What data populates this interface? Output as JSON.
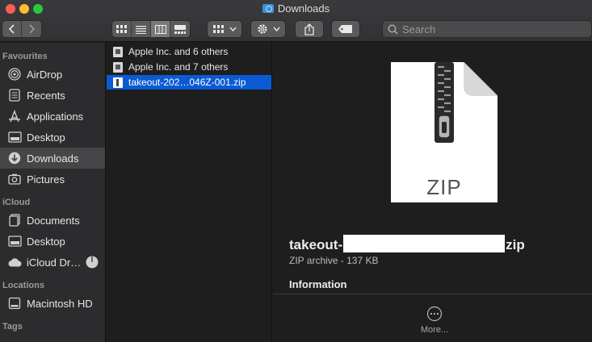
{
  "window": {
    "title": "Downloads"
  },
  "toolbar": {
    "view_modes": [
      "icon-view",
      "list-view",
      "column-view",
      "gallery-view"
    ],
    "active_view": "column-view"
  },
  "search": {
    "placeholder": "Search"
  },
  "sidebar": {
    "sections": [
      {
        "header": "Favourites",
        "items": [
          {
            "label": "AirDrop",
            "icon": "airdrop-icon"
          },
          {
            "label": "Recents",
            "icon": "recents-icon"
          },
          {
            "label": "Applications",
            "icon": "applications-icon"
          },
          {
            "label": "Desktop",
            "icon": "desktop-icon"
          },
          {
            "label": "Downloads",
            "icon": "downloads-icon",
            "selected": true
          },
          {
            "label": "Pictures",
            "icon": "pictures-icon"
          }
        ]
      },
      {
        "header": "iCloud",
        "items": [
          {
            "label": "Documents",
            "icon": "documents-icon"
          },
          {
            "label": "Desktop",
            "icon": "desktop-icon"
          },
          {
            "label": "iCloud Dr…",
            "icon": "icloud-icon"
          }
        ]
      },
      {
        "header": "Locations",
        "items": [
          {
            "label": "Macintosh HD",
            "icon": "harddisk-icon"
          }
        ]
      },
      {
        "header": "Tags",
        "items": []
      }
    ]
  },
  "files": [
    {
      "name": "Apple Inc. and 6 others"
    },
    {
      "name": "Apple Inc. and 7 others"
    },
    {
      "name": "takeout-202…046Z-001.zip",
      "selected": true
    }
  ],
  "preview": {
    "icon_label": "ZIP",
    "name_prefix": "takeout-",
    "name_suffix": "zip",
    "kind": "ZIP archive - 137 KB",
    "section": "Information",
    "more_label": "More..."
  },
  "colors": {
    "accent": "#0a5bd3",
    "close": "#fe5f57",
    "minimize": "#febc2e",
    "maximize": "#28c840",
    "folder": "#3b8fd8"
  }
}
